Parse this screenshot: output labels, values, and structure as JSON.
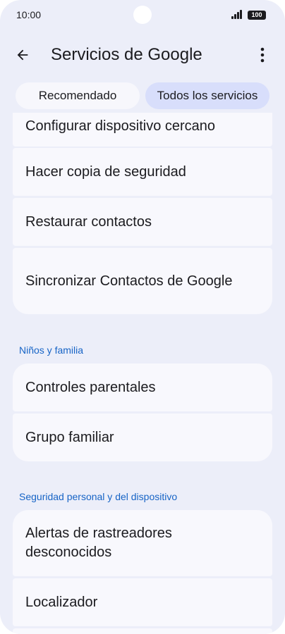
{
  "status": {
    "time": "10:00",
    "battery": "100"
  },
  "appbar": {
    "title": "Servicios de Google"
  },
  "tabs": [
    "Recomendado",
    "Todos los servicios"
  ],
  "groups": [
    {
      "items": [
        "Configurar dispositivo cercano",
        "Hacer copia de seguridad",
        "Restaurar contactos",
        "Sincronizar Contactos de Google"
      ]
    },
    {
      "header": "Niños y familia",
      "items": [
        "Controles parentales",
        "Grupo familiar"
      ]
    },
    {
      "header": "Seguridad personal y del dispositivo",
      "items": [
        "Alertas de rastreadores desconocidos",
        "Localizador"
      ]
    }
  ],
  "colors": {
    "background": "#eceef9",
    "card": "#f8f8fd",
    "selected_tab": "#d8defb",
    "section_header": "#1764c6"
  },
  "icons": {
    "back": "arrow-left-icon",
    "menu": "more-vert-icon"
  }
}
